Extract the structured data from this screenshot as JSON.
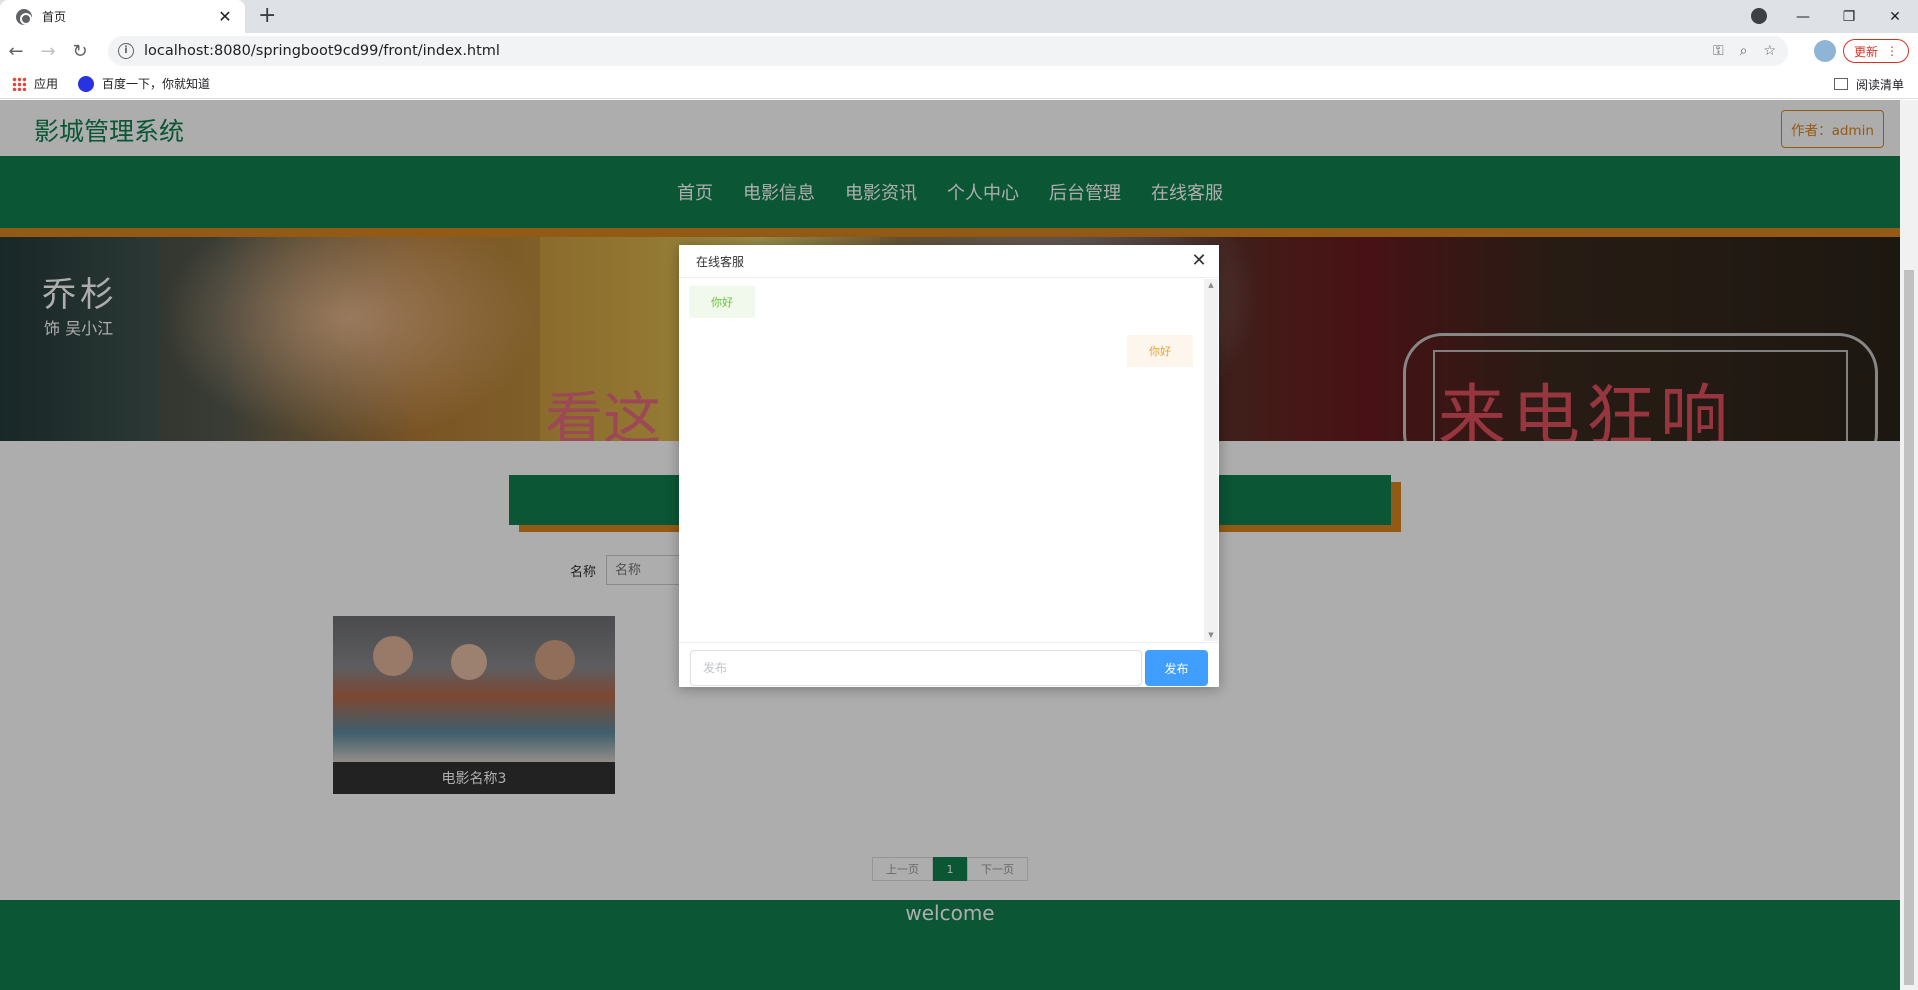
{
  "browser": {
    "tab_title": "首页",
    "url": "localhost:8080/springboot9cd99/front/index.html",
    "update_label": "更新",
    "bookmarks": [
      {
        "label": "应用",
        "icon": "apps-grid-icon"
      },
      {
        "label": "百度一下，你就知道",
        "icon": "baidu-icon"
      }
    ],
    "reading_list_label": "阅读清单"
  },
  "site": {
    "title": "影城管理系统",
    "author_label": "作者：admin",
    "nav": [
      "首页",
      "电影信息",
      "电影资讯",
      "个人中心",
      "后台管理",
      "在线客服"
    ],
    "colors": {
      "primary": "#0f7f4f",
      "accent": "#d9851f"
    }
  },
  "banner": {
    "actor_name": "乔杉",
    "actor_role": "饰 吴小江",
    "slogan": "看这",
    "movie_title": "来电狂响"
  },
  "search": {
    "label": "名称",
    "placeholder": "名称"
  },
  "movies": [
    {
      "name": "电影名称3"
    }
  ],
  "pagination": {
    "prev_label": "上一页",
    "current_page": "1",
    "next_label": "下一页"
  },
  "footer": {
    "text": "welcome"
  },
  "chat_dialog": {
    "title": "在线客服",
    "messages": [
      {
        "side": "left",
        "text": "你好"
      },
      {
        "side": "right",
        "text": "你好"
      }
    ],
    "input_placeholder": "发布",
    "send_label": "发布"
  }
}
